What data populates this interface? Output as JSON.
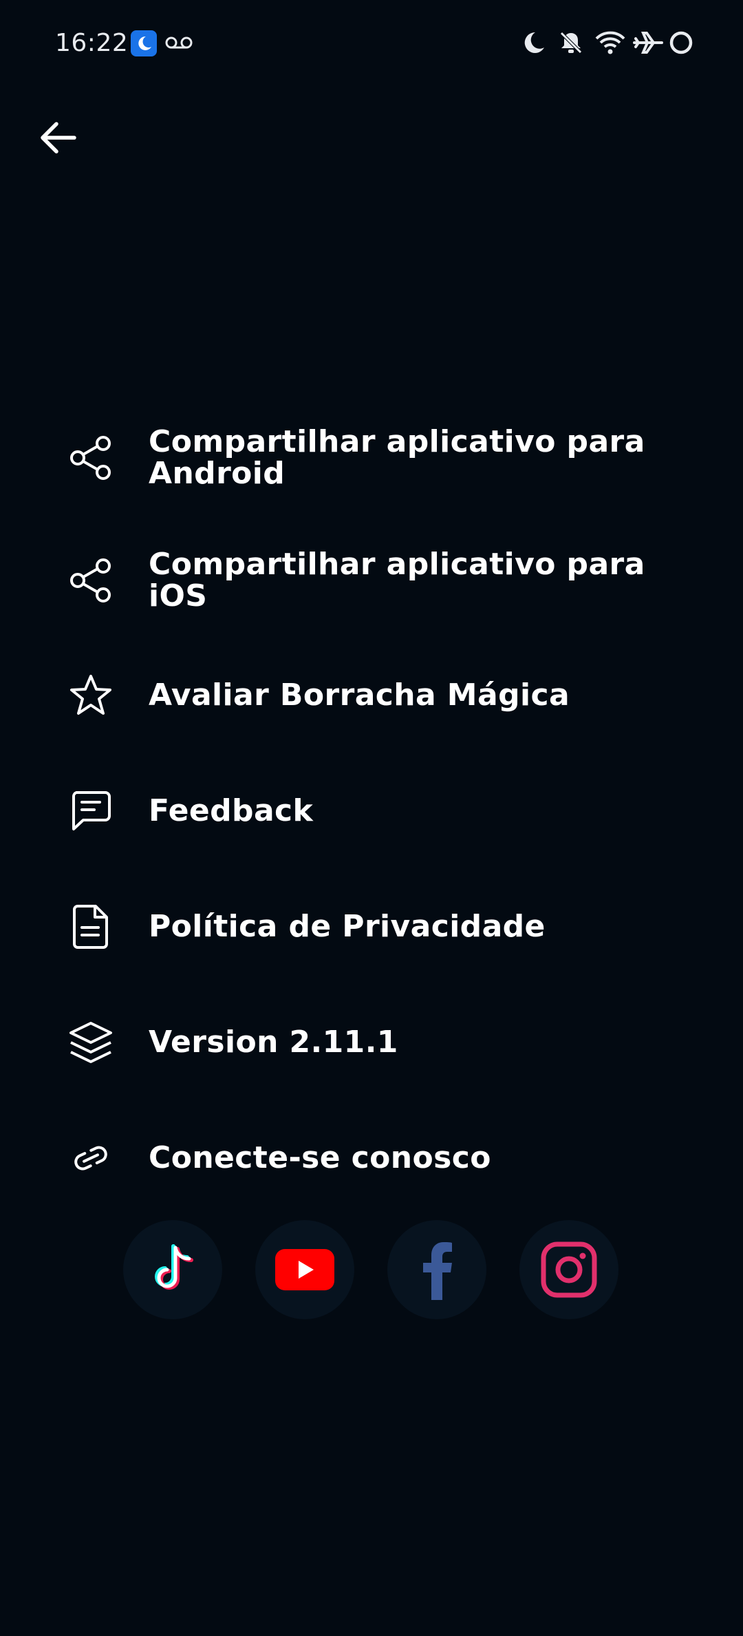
{
  "status_bar": {
    "time": "16:22",
    "icons_left": [
      "bedtime-badge-icon",
      "voicemail-icon"
    ],
    "icons_right": [
      "do-not-disturb-moon-icon",
      "notifications-off-icon",
      "wifi-icon",
      "airplane-mode-icon",
      "battery-ring-icon"
    ]
  },
  "header": {
    "back_icon": "arrow-left-icon"
  },
  "menu": {
    "items": [
      {
        "label": "Compartilhar aplicativo para Android",
        "icon": "share-icon"
      },
      {
        "label": "Compartilhar aplicativo para iOS",
        "icon": "share-icon"
      },
      {
        "label": "Avaliar Borracha Mágica",
        "icon": "star-icon"
      },
      {
        "label": "Feedback",
        "icon": "message-icon"
      },
      {
        "label": "Política de Privacidade",
        "icon": "document-icon"
      },
      {
        "label": "Version 2.11.1",
        "icon": "layers-icon"
      },
      {
        "label": "Conecte-se conosco",
        "icon": "link-icon"
      }
    ]
  },
  "social": {
    "items": [
      {
        "icon": "tiktok-icon",
        "color": "#ee1d52"
      },
      {
        "icon": "youtube-icon",
        "color": "#ff0000"
      },
      {
        "icon": "facebook-icon",
        "color": "#3b5998"
      },
      {
        "icon": "instagram-icon",
        "color": "#e1306c"
      }
    ]
  },
  "colors": {
    "background": "#030a12",
    "text": "#ffffff",
    "social_bg": "#07131f"
  }
}
